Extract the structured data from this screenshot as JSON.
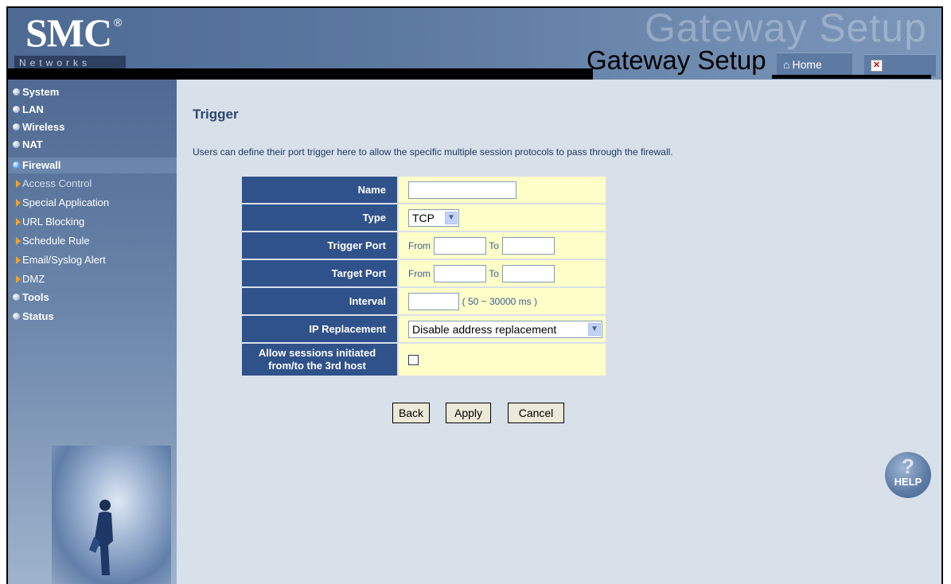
{
  "header": {
    "logo": "SMC",
    "logo_mark": "®",
    "logo_sub": "Networks",
    "watermark": "Gateway Setup",
    "title": "Gateway Setup",
    "home_label": "Home",
    "close_icon": "close-icon"
  },
  "sidebar": {
    "items": [
      {
        "label": "System"
      },
      {
        "label": "LAN"
      },
      {
        "label": "Wireless"
      },
      {
        "label": "NAT"
      },
      {
        "label": "Firewall",
        "active": true
      },
      {
        "label": "Tools"
      },
      {
        "label": "Status"
      }
    ],
    "firewall_sub": [
      {
        "label": "Access Control",
        "current": true
      },
      {
        "label": "Special Application"
      },
      {
        "label": "URL Blocking"
      },
      {
        "label": "Schedule Rule"
      },
      {
        "label": "Email/Syslog Alert"
      },
      {
        "label": "DMZ"
      }
    ]
  },
  "main": {
    "title": "Trigger",
    "description": "Users can define their port trigger here to allow the specific multiple session protocols to pass through the firewall.",
    "form": {
      "name_label": "Name",
      "name_value": "",
      "type_label": "Type",
      "type_value": "TCP",
      "trigger_port_label": "Trigger Port",
      "target_port_label": "Target Port",
      "from_label": "From",
      "to_label": "To",
      "interval_label": "Interval",
      "interval_hint": "( 50 ~ 30000 ms )",
      "ip_replacement_label": "IP Replacement",
      "ip_replacement_value": "Disable address replacement",
      "allow_label_line1": "Allow sessions initiated",
      "allow_label_line2": "from/to the 3rd host",
      "allow_checked": false
    },
    "buttons": {
      "back": "Back",
      "apply": "Apply",
      "cancel": "Cancel"
    },
    "help_label": "HELP"
  },
  "colors": {
    "header_bg": "#5b789f",
    "label_cell_bg": "#30528b",
    "value_cell_bg": "#fefec8",
    "content_bg": "#d8e0ea",
    "title_color": "#2c4770",
    "sub_arrow": "#f7a21c"
  }
}
